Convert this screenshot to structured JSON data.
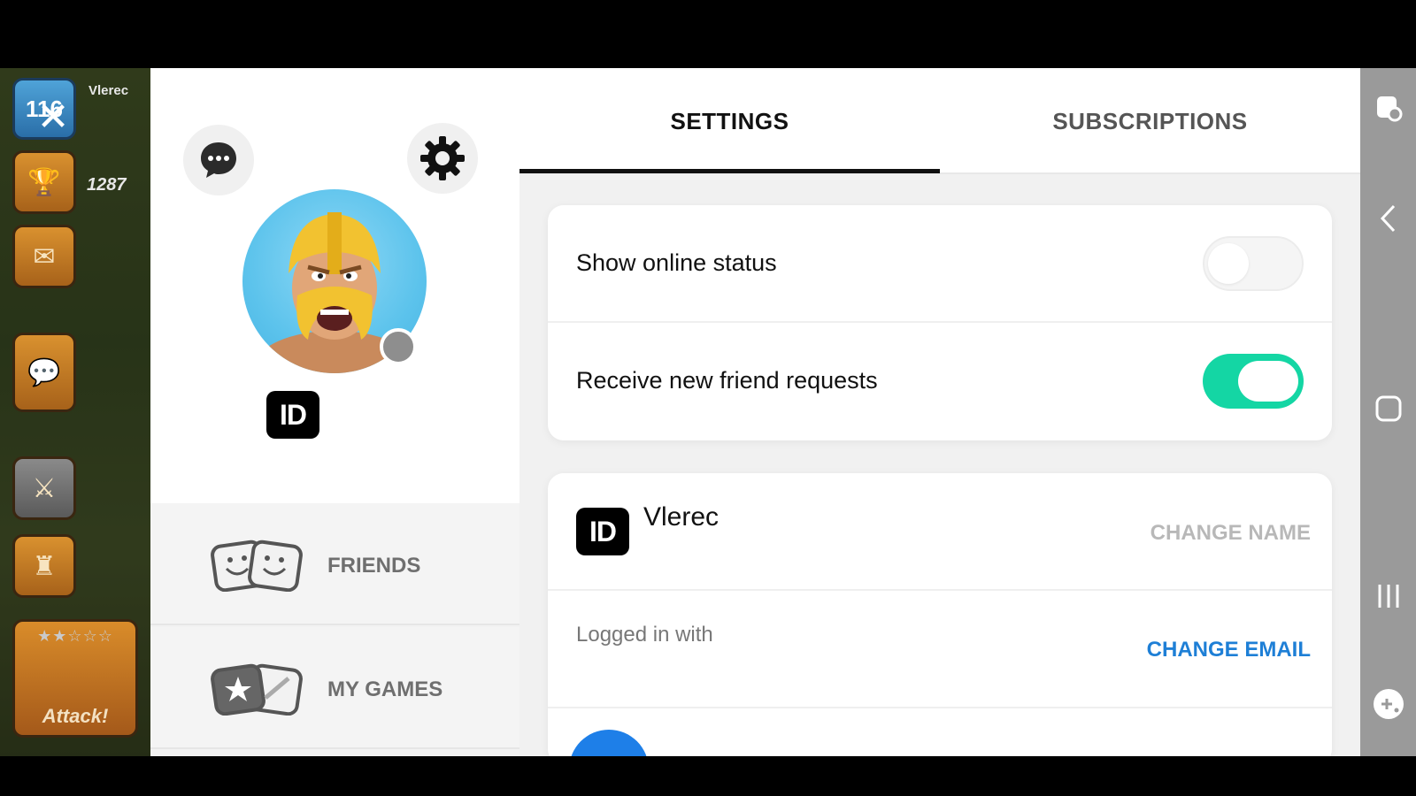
{
  "game": {
    "player_name": "Vlerec",
    "level": "116",
    "trophies": "1287",
    "attack_label": "Attack!",
    "attack_stars": "★★☆☆☆"
  },
  "close_glyph": "✕",
  "profile": {
    "chat_icon": "chat-bubble-icon",
    "settings_icon": "gear-icon",
    "avatar_alt": "Barbarian avatar",
    "online_status": "offline",
    "id_badge": "ID",
    "nav": [
      {
        "label": "FRIENDS",
        "icon": "friends-masks-icon"
      },
      {
        "label": "MY GAMES",
        "icon": "games-cards-icon"
      }
    ]
  },
  "tabs": {
    "settings": "SETTINGS",
    "subscriptions": "SUBSCRIPTIONS",
    "active": "settings"
  },
  "privacy": {
    "show_online_status": {
      "label": "Show online status",
      "enabled": false
    },
    "friend_requests": {
      "label": "Receive new friend requests",
      "enabled": true
    }
  },
  "account": {
    "id_badge": "ID",
    "name": "Vlerec",
    "change_name": "CHANGE NAME",
    "logged_in_label": "Logged in with",
    "change_email": "CHANGE EMAIL"
  },
  "colors": {
    "toggle_on": "#14d6a4",
    "link_blue": "#1e7fd6",
    "link_grey": "#b8b8b8",
    "tab_active": "#111111"
  }
}
